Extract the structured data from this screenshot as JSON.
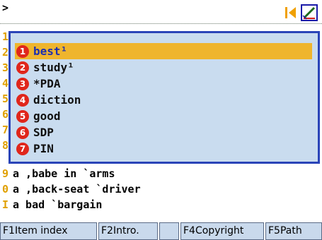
{
  "top": {
    "prompt": ">",
    "icons": [
      "go-back-icon",
      "edit-icon"
    ]
  },
  "background_list": [
    {
      "num": "1",
      "text": ""
    },
    {
      "num": "2",
      "text": ""
    },
    {
      "num": "3",
      "text": ""
    },
    {
      "num": "4",
      "text": ""
    },
    {
      "num": "5",
      "text": ""
    },
    {
      "num": "6",
      "text": ""
    },
    {
      "num": "7",
      "text": ""
    },
    {
      "num": "8",
      "text": ""
    },
    {
      "num": "9",
      "text": "a ,babe in `arms"
    },
    {
      "num": "0",
      "text": "a ,back-seat `driver"
    },
    {
      "num": "I",
      "text": "a bad `bargain"
    }
  ],
  "popup": {
    "selected_index": 0,
    "items": [
      {
        "marker": "1",
        "text": "best¹"
      },
      {
        "marker": "2",
        "text": "study¹"
      },
      {
        "marker": "3",
        "text": "*PDA"
      },
      {
        "marker": "4",
        "text": "diction"
      },
      {
        "marker": "5",
        "text": "good"
      },
      {
        "marker": "6",
        "text": "SDP"
      },
      {
        "marker": "7",
        "text": "PIN"
      }
    ],
    "colors": {
      "border": "#2a44b8",
      "background": "#c9dcef",
      "highlight": "#efb52d",
      "marker": "#e0261b"
    }
  },
  "fkeys": [
    {
      "label": "F1Item index"
    },
    {
      "label": "F2Intro."
    },
    {
      "label": ""
    },
    {
      "label": "F4Copyright"
    },
    {
      "label": "F5Path"
    }
  ]
}
